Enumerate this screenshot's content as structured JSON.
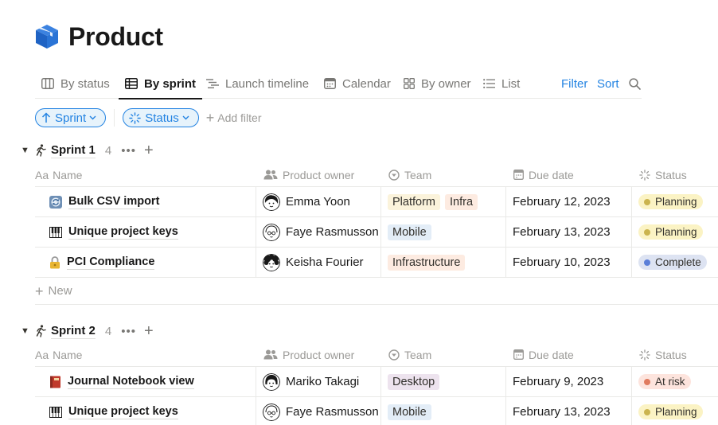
{
  "page": {
    "title": "Product",
    "icon": "cube-icon"
  },
  "tabs": [
    {
      "label": "By status",
      "icon": "board-icon"
    },
    {
      "label": "By sprint",
      "icon": "table-icon"
    },
    {
      "label": "Launch timeline",
      "icon": "timeline-icon"
    },
    {
      "label": "Calendar",
      "icon": "calendar-icon"
    },
    {
      "label": "By owner",
      "icon": "gallery-icon"
    },
    {
      "label": "List",
      "icon": "list-icon"
    }
  ],
  "active_tab": "By sprint",
  "actions": {
    "filter": "Filter",
    "sort": "Sort",
    "search_icon": "search-icon"
  },
  "filters": {
    "sprint": "Sprint",
    "status": "Status",
    "add_filter": "Add filter"
  },
  "columns": {
    "name": "Name",
    "owner": "Product owner",
    "team": "Team",
    "due": "Due date",
    "status": "Status"
  },
  "new_label": "New",
  "colors": {
    "accent": "#2383e2",
    "tag_yellow": "#fbf3db",
    "tag_orange": "#fdebe1",
    "tag_blue": "#e3edf7",
    "tag_purple": "#ede3ee",
    "status_planning_bg": "#fbf3c4",
    "status_planning_dot": "#cbb44e",
    "status_complete_bg": "#dde3f2",
    "status_complete_dot": "#5b7fd8",
    "status_risk_bg": "#fde4dd",
    "status_risk_dot": "#e07b5f"
  },
  "groups": [
    {
      "name": "Sprint 1",
      "count": "4",
      "rows": [
        {
          "icon": "sync-icon",
          "name": "Bulk CSV import",
          "owner": "Emma Yoon",
          "teams": [
            "Platform",
            "Infra"
          ],
          "due": "February 12, 2023",
          "status": "Planning"
        },
        {
          "icon": "piano-icon",
          "name": "Unique project keys",
          "owner": "Faye Rasmusson",
          "teams": [
            "Mobile"
          ],
          "due": "February 13, 2023",
          "status": "Planning"
        },
        {
          "icon": "lock-icon",
          "name": "PCI Compliance",
          "owner": "Keisha Fourier",
          "teams": [
            "Infrastructure"
          ],
          "due": "February 10, 2023",
          "status": "Complete"
        }
      ]
    },
    {
      "name": "Sprint 2",
      "count": "4",
      "rows": [
        {
          "icon": "notebook-icon",
          "name": "Journal Notebook view",
          "owner": "Mariko Takagi",
          "teams": [
            "Desktop"
          ],
          "due": "February 9, 2023",
          "status": "At risk"
        },
        {
          "icon": "piano-icon",
          "name": "Unique project keys",
          "owner": "Faye Rasmusson",
          "teams": [
            "Mobile"
          ],
          "due": "February 13, 2023",
          "status": "Planning"
        }
      ]
    }
  ]
}
